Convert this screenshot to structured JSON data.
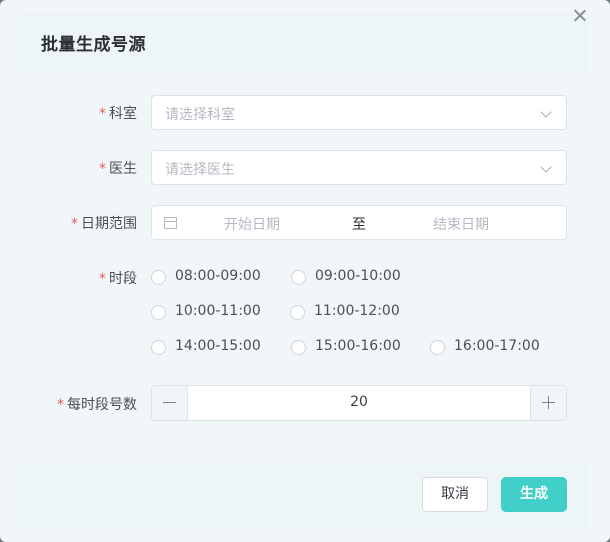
{
  "dialog": {
    "title": "批量生成号源",
    "close_icon": "close-icon"
  },
  "form": {
    "department": {
      "label": "科室",
      "placeholder": "请选择科室"
    },
    "doctor": {
      "label": "医生",
      "placeholder": "请选择医生"
    },
    "date_range": {
      "label": "日期范围",
      "start_placeholder": "开始日期",
      "separator": "至",
      "end_placeholder": "结束日期"
    },
    "time_slots": {
      "label": "时段",
      "options": [
        "08:00-09:00",
        "09:00-10:00",
        "10:00-11:00",
        "11:00-12:00",
        "14:00-15:00",
        "15:00-16:00",
        "16:00-17:00"
      ]
    },
    "per_slot_count": {
      "label": "每时段号数",
      "value": "20"
    },
    "required_mark": "*"
  },
  "footer": {
    "cancel_label": "取消",
    "confirm_label": "生成"
  },
  "colors": {
    "accent": "#40cfc9",
    "required": "#e05a5a"
  }
}
